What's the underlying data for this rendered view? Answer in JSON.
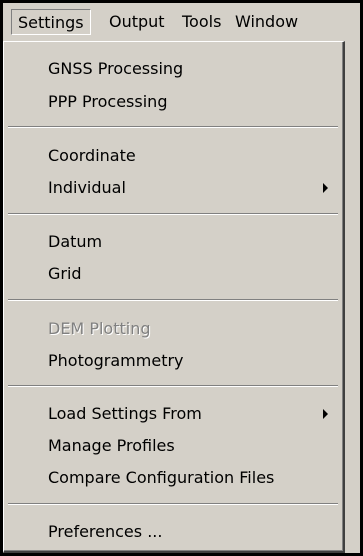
{
  "menubar": {
    "items": [
      {
        "label": "Settings"
      },
      {
        "label": "Output"
      },
      {
        "label": "Tools"
      },
      {
        "label": "Window"
      }
    ]
  },
  "settings_menu": {
    "gnss_processing": "GNSS Processing",
    "ppp_processing": "PPP Processing",
    "coordinate": "Coordinate",
    "individual": "Individual",
    "datum": "Datum",
    "grid": "Grid",
    "dem_plotting": "DEM Plotting",
    "photogrammetry": "Photogrammetry",
    "load_settings_from": "Load Settings From",
    "manage_profiles": "Manage Profiles",
    "compare_configuration_files": "Compare Configuration Files",
    "preferences": "Preferences ..."
  }
}
